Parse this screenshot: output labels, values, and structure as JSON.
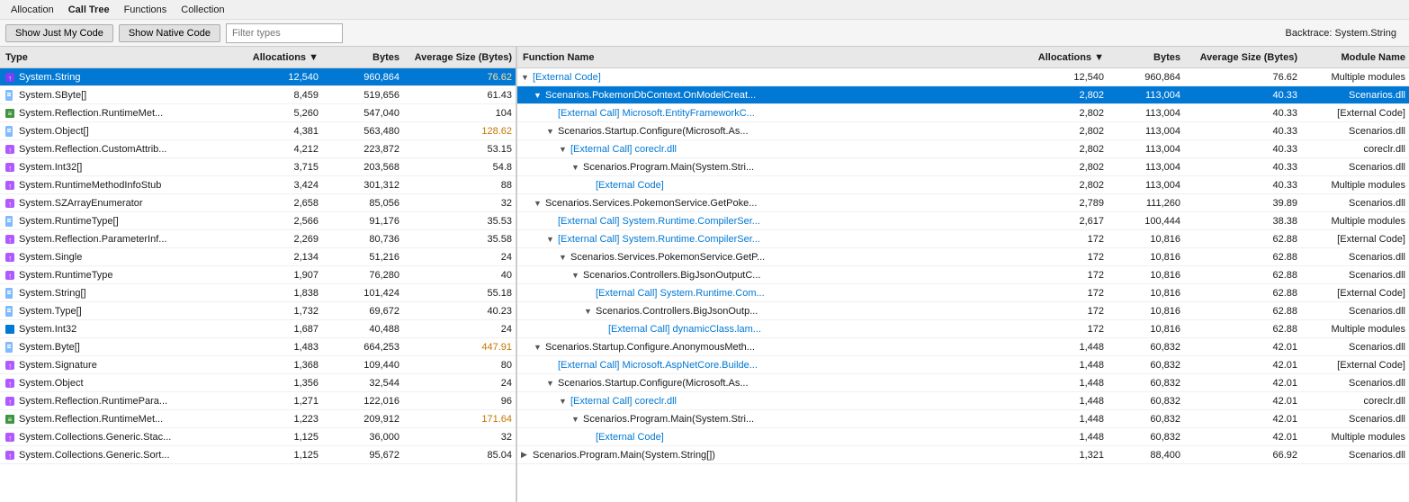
{
  "menuBar": {
    "items": [
      "Allocation",
      "Call Tree",
      "Functions",
      "Collection"
    ]
  },
  "toolbar": {
    "btn1": "Show Just My Code",
    "btn2": "Show Native Code",
    "filterPlaceholder": "Filter types",
    "backtrace": "Backtrace: System.String"
  },
  "tabs": [
    {
      "label": "Call Tree",
      "active": true
    }
  ],
  "leftPanel": {
    "columns": [
      "Type",
      "Allocations▼",
      "Bytes",
      "Average Size (Bytes)"
    ],
    "rows": [
      {
        "icon": "🔷",
        "type": "System.String",
        "allocations": "12,540",
        "bytes": "960,864",
        "avg": "76.62",
        "selected": true,
        "accent_avg": true
      },
      {
        "icon": "📄",
        "type": "System.SByte[]",
        "allocations": "8,459",
        "bytes": "519,656",
        "avg": "61.43",
        "selected": false
      },
      {
        "icon": "📋",
        "type": "System.Reflection.RuntimeMet...",
        "allocations": "5,260",
        "bytes": "547,040",
        "avg": "104",
        "selected": false
      },
      {
        "icon": "📄",
        "type": "System.Object[]",
        "allocations": "4,381",
        "bytes": "563,480",
        "avg": "128.62",
        "selected": false,
        "accent_avg": true
      },
      {
        "icon": "🔷",
        "type": "System.Reflection.CustomAttrib...",
        "allocations": "4,212",
        "bytes": "223,872",
        "avg": "53.15",
        "selected": false
      },
      {
        "icon": "🔷",
        "type": "System.Int32[]",
        "allocations": "3,715",
        "bytes": "203,568",
        "avg": "54.8",
        "selected": false
      },
      {
        "icon": "🔷",
        "type": "System.RuntimeMethodInfoStub",
        "allocations": "3,424",
        "bytes": "301,312",
        "avg": "88",
        "selected": false
      },
      {
        "icon": "🔷",
        "type": "System.SZArrayEnumerator",
        "allocations": "2,658",
        "bytes": "85,056",
        "avg": "32",
        "selected": false
      },
      {
        "icon": "📄",
        "type": "System.RuntimeType[]",
        "allocations": "2,566",
        "bytes": "91,176",
        "avg": "35.53",
        "selected": false
      },
      {
        "icon": "🔷",
        "type": "System.Reflection.ParameterInf...",
        "allocations": "2,269",
        "bytes": "80,736",
        "avg": "35.58",
        "selected": false
      },
      {
        "icon": "🔷",
        "type": "System.Single",
        "allocations": "2,134",
        "bytes": "51,216",
        "avg": "24",
        "selected": false
      },
      {
        "icon": "🔷",
        "type": "System.RuntimeType",
        "allocations": "1,907",
        "bytes": "76,280",
        "avg": "40",
        "selected": false
      },
      {
        "icon": "📄",
        "type": "System.String[]",
        "allocations": "1,838",
        "bytes": "101,424",
        "avg": "55.18",
        "selected": false
      },
      {
        "icon": "📄",
        "type": "System.Type[]",
        "allocations": "1,732",
        "bytes": "69,672",
        "avg": "40.23",
        "selected": false
      },
      {
        "icon": "🔲",
        "type": "System.Int32",
        "allocations": "1,687",
        "bytes": "40,488",
        "avg": "24",
        "selected": false
      },
      {
        "icon": "📄",
        "type": "System.Byte[]",
        "allocations": "1,483",
        "bytes": "664,253",
        "avg": "447.91",
        "selected": false,
        "accent_avg": true
      },
      {
        "icon": "🔷",
        "type": "System.Signature",
        "allocations": "1,368",
        "bytes": "109,440",
        "avg": "80",
        "selected": false
      },
      {
        "icon": "🔷",
        "type": "System.Object",
        "allocations": "1,356",
        "bytes": "32,544",
        "avg": "24",
        "selected": false
      },
      {
        "icon": "🔷",
        "type": "System.Reflection.RuntimePara...",
        "allocations": "1,271",
        "bytes": "122,016",
        "avg": "96",
        "selected": false
      },
      {
        "icon": "📋",
        "type": "System.Reflection.RuntimeMet...",
        "allocations": "1,223",
        "bytes": "209,912",
        "avg": "171.64",
        "selected": false,
        "accent_avg": true
      },
      {
        "icon": "🔷",
        "type": "System.Collections.Generic.Stac...",
        "allocations": "1,125",
        "bytes": "36,000",
        "avg": "32",
        "selected": false
      },
      {
        "icon": "🔷",
        "type": "System.Collections.Generic.Sort...",
        "allocations": "1,125",
        "bytes": "95,672",
        "avg": "85.04",
        "selected": false
      }
    ]
  },
  "rightPanel": {
    "columns": [
      "Function Name",
      "Allocations▼",
      "Bytes",
      "Average Size (Bytes)",
      "Module Name"
    ],
    "rows": [
      {
        "indent": 0,
        "expand": "▼",
        "external": true,
        "name": "[External Code]",
        "allocations": "12,540",
        "bytes": "960,864",
        "avg": "76.62",
        "module": "Multiple modules",
        "selected": false
      },
      {
        "indent": 1,
        "expand": "▼",
        "external": false,
        "name": "Scenarios.PokemonDbContext.OnModelCreat...",
        "allocations": "2,802",
        "bytes": "113,004",
        "avg": "40.33",
        "module": "Scenarios.dll",
        "selected": true
      },
      {
        "indent": 2,
        "expand": null,
        "external": true,
        "name": "[External Call] Microsoft.EntityFrameworkC...",
        "allocations": "2,802",
        "bytes": "113,004",
        "avg": "40.33",
        "module": "[External Code]",
        "selected": false
      },
      {
        "indent": 2,
        "expand": "▼",
        "external": false,
        "name": "Scenarios.Startup.Configure(Microsoft.As...",
        "allocations": "2,802",
        "bytes": "113,004",
        "avg": "40.33",
        "module": "Scenarios.dll",
        "selected": false
      },
      {
        "indent": 3,
        "expand": "▼",
        "external": true,
        "name": "[External Call] coreclr.dll",
        "allocations": "2,802",
        "bytes": "113,004",
        "avg": "40.33",
        "module": "coreclr.dll",
        "selected": false
      },
      {
        "indent": 4,
        "expand": "▼",
        "external": false,
        "name": "Scenarios.Program.Main(System.Stri...",
        "allocations": "2,802",
        "bytes": "113,004",
        "avg": "40.33",
        "module": "Scenarios.dll",
        "selected": false
      },
      {
        "indent": 5,
        "expand": null,
        "external": true,
        "name": "[External Code]",
        "allocations": "2,802",
        "bytes": "113,004",
        "avg": "40.33",
        "module": "Multiple modules",
        "selected": false
      },
      {
        "indent": 1,
        "expand": "▼",
        "external": false,
        "name": "Scenarios.Services.PokemonService.GetPoke...",
        "allocations": "2,789",
        "bytes": "111,260",
        "avg": "39.89",
        "module": "Scenarios.dll",
        "selected": false
      },
      {
        "indent": 2,
        "expand": null,
        "external": true,
        "name": "[External Call] System.Runtime.CompilerSer...",
        "allocations": "2,617",
        "bytes": "100,444",
        "avg": "38.38",
        "module": "Multiple modules",
        "selected": false
      },
      {
        "indent": 2,
        "expand": "▼",
        "external": true,
        "name": "[External Call] System.Runtime.CompilerSer...",
        "allocations": "172",
        "bytes": "10,816",
        "avg": "62.88",
        "module": "[External Code]",
        "selected": false
      },
      {
        "indent": 3,
        "expand": "▼",
        "external": false,
        "name": "Scenarios.Services.PokemonService.GetP...",
        "allocations": "172",
        "bytes": "10,816",
        "avg": "62.88",
        "module": "Scenarios.dll",
        "selected": false
      },
      {
        "indent": 4,
        "expand": "▼",
        "external": false,
        "name": "Scenarios.Controllers.BigJsonOutputC...",
        "allocations": "172",
        "bytes": "10,816",
        "avg": "62.88",
        "module": "Scenarios.dll",
        "selected": false
      },
      {
        "indent": 5,
        "expand": null,
        "external": true,
        "name": "[External Call] System.Runtime.Com...",
        "allocations": "172",
        "bytes": "10,816",
        "avg": "62.88",
        "module": "[External Code]",
        "selected": false
      },
      {
        "indent": 5,
        "expand": "▼",
        "external": false,
        "name": "Scenarios.Controllers.BigJsonOutp...",
        "allocations": "172",
        "bytes": "10,816",
        "avg": "62.88",
        "module": "Scenarios.dll",
        "selected": false
      },
      {
        "indent": 6,
        "expand": null,
        "external": true,
        "name": "[External Call] dynamicClass.lam...",
        "allocations": "172",
        "bytes": "10,816",
        "avg": "62.88",
        "module": "Multiple modules",
        "selected": false
      },
      {
        "indent": 1,
        "expand": "▼",
        "external": false,
        "name": "Scenarios.Startup.Configure.AnonymousMeth...",
        "allocations": "1,448",
        "bytes": "60,832",
        "avg": "42.01",
        "module": "Scenarios.dll",
        "selected": false
      },
      {
        "indent": 2,
        "expand": null,
        "external": true,
        "name": "[External Call] Microsoft.AspNetCore.Builde...",
        "allocations": "1,448",
        "bytes": "60,832",
        "avg": "42.01",
        "module": "[External Code]",
        "selected": false
      },
      {
        "indent": 2,
        "expand": "▼",
        "external": false,
        "name": "Scenarios.Startup.Configure(Microsoft.As...",
        "allocations": "1,448",
        "bytes": "60,832",
        "avg": "42.01",
        "module": "Scenarios.dll",
        "selected": false
      },
      {
        "indent": 3,
        "expand": "▼",
        "external": true,
        "name": "[External Call] coreclr.dll",
        "allocations": "1,448",
        "bytes": "60,832",
        "avg": "42.01",
        "module": "coreclr.dll",
        "selected": false
      },
      {
        "indent": 4,
        "expand": "▼",
        "external": false,
        "name": "Scenarios.Program.Main(System.Stri...",
        "allocations": "1,448",
        "bytes": "60,832",
        "avg": "42.01",
        "module": "Scenarios.dll",
        "selected": false
      },
      {
        "indent": 5,
        "expand": null,
        "external": true,
        "name": "[External Code]",
        "allocations": "1,448",
        "bytes": "60,832",
        "avg": "42.01",
        "module": "Multiple modules",
        "selected": false
      },
      {
        "indent": 0,
        "expand": "▶",
        "external": false,
        "name": "Scenarios.Program.Main(System.String[])",
        "allocations": "1,321",
        "bytes": "88,400",
        "avg": "66.92",
        "module": "Scenarios.dll",
        "selected": false
      }
    ]
  }
}
